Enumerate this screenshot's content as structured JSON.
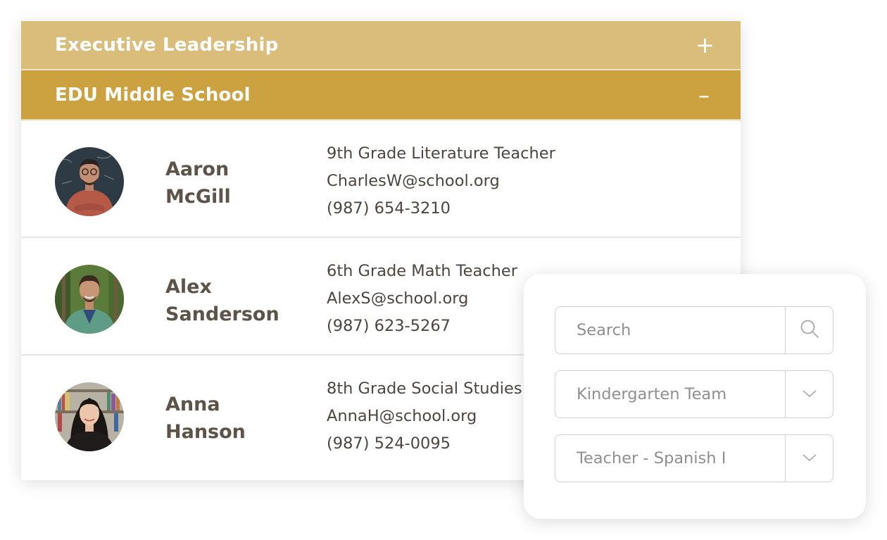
{
  "directory": {
    "sections": [
      {
        "title": "Executive Leadership",
        "toggle": "+",
        "expanded": false
      },
      {
        "title": "EDU Middle School",
        "toggle": "–",
        "expanded": true
      }
    ],
    "people": [
      {
        "first_name": "Aaron",
        "last_name": "McGill",
        "role": "9th Grade Literature Teacher",
        "email": "CharlesW@school.org",
        "phone": "(987) 654-3210"
      },
      {
        "first_name": "Alex",
        "last_name": "Sanderson",
        "role": "6th Grade Math Teacher",
        "email": "AlexS@school.org",
        "phone": "(987) 623-5267"
      },
      {
        "first_name": "Anna",
        "last_name": "Hanson",
        "role": "8th Grade Social Studies",
        "email": "AnnaH@school.org",
        "phone": "(987) 524-0095"
      }
    ]
  },
  "filters": {
    "search_placeholder": "Search",
    "team_select": "Kindergarten Team",
    "position_select": "Teacher - Spanish I",
    "icons": [
      "search-icon",
      "chevron-down-icon"
    ]
  },
  "colors": {
    "header_collapsed": "#dbbd7b",
    "header_expanded": "#cca241",
    "name_text": "#5d5348",
    "detail_text": "#4d4640"
  }
}
